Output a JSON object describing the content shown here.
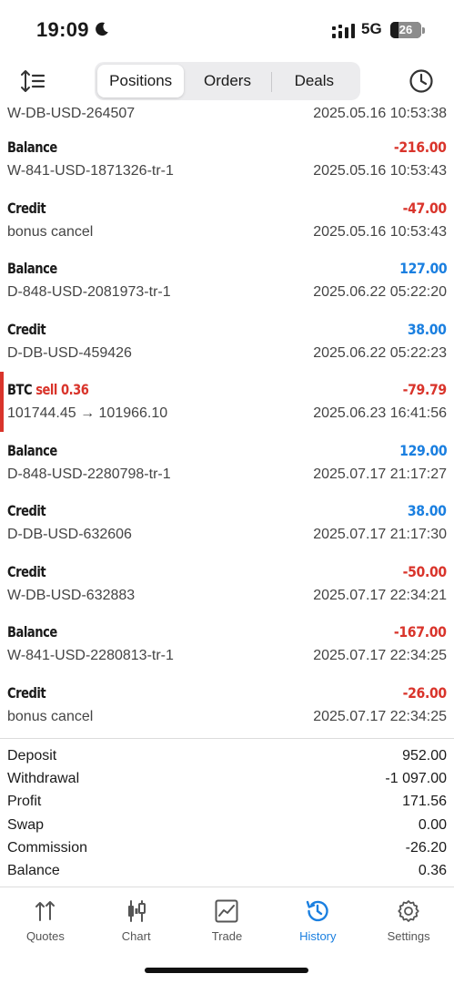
{
  "status_bar": {
    "time": "19:09",
    "network": "5G",
    "battery": "26",
    "battery_level": 0.26
  },
  "toolbar": {
    "tabs": [
      {
        "label": "Positions",
        "active": true
      },
      {
        "label": "Orders",
        "active": false
      },
      {
        "label": "Deals",
        "active": false
      }
    ]
  },
  "deals": [
    {
      "title": "",
      "amount": "",
      "sub": "W-DB-USD-264507",
      "time": "2025.05.16 10:53:38",
      "partial": true
    },
    {
      "title": "Balance",
      "amount": "-216.00",
      "sign": "neg",
      "sub": "W-841-USD-1871326-tr-1",
      "time": "2025.05.16 10:53:43"
    },
    {
      "title": "Credit",
      "amount": "-47.00",
      "sign": "neg",
      "sub": "bonus cancel",
      "time": "2025.05.16 10:53:43"
    },
    {
      "title": "Balance",
      "amount": "127.00",
      "sign": "pos",
      "sub": "D-848-USD-2081973-tr-1",
      "time": "2025.06.22 05:22:20"
    },
    {
      "title": "Credit",
      "amount": "38.00",
      "sign": "pos",
      "sub": "D-DB-USD-459426",
      "time": "2025.06.22 05:22:23"
    },
    {
      "title": "BTC",
      "title_extra": "sell 0.36",
      "amount": "-79.79",
      "sign": "neg",
      "sub": "101744.45 → 101966.10",
      "time": "2025.06.23 16:41:56",
      "trade": true
    },
    {
      "title": "Balance",
      "amount": "129.00",
      "sign": "pos",
      "sub": "D-848-USD-2280798-tr-1",
      "time": "2025.07.17 21:17:27"
    },
    {
      "title": "Credit",
      "amount": "38.00",
      "sign": "pos",
      "sub": "D-DB-USD-632606",
      "time": "2025.07.17 21:17:30"
    },
    {
      "title": "Credit",
      "amount": "-50.00",
      "sign": "neg",
      "sub": "W-DB-USD-632883",
      "time": "2025.07.17 22:34:21"
    },
    {
      "title": "Balance",
      "amount": "-167.00",
      "sign": "neg",
      "sub": "W-841-USD-2280813-tr-1",
      "time": "2025.07.17 22:34:25"
    },
    {
      "title": "Credit",
      "amount": "-26.00",
      "sign": "neg",
      "sub": "bonus cancel",
      "time": "2025.07.17 22:34:25"
    }
  ],
  "summary": [
    {
      "label": "Deposit",
      "value": "952.00"
    },
    {
      "label": "Withdrawal",
      "value": "-1 097.00"
    },
    {
      "label": "Profit",
      "value": "171.56"
    },
    {
      "label": "Swap",
      "value": "0.00"
    },
    {
      "label": "Commission",
      "value": "-26.20"
    },
    {
      "label": "Balance",
      "value": "0.36"
    }
  ],
  "tabbar": {
    "items": [
      {
        "label": "Quotes",
        "icon": "quotes-icon",
        "active": false
      },
      {
        "label": "Chart",
        "icon": "chart-icon",
        "active": false
      },
      {
        "label": "Trade",
        "icon": "trade-icon",
        "active": false
      },
      {
        "label": "History",
        "icon": "history-icon",
        "active": true
      },
      {
        "label": "Settings",
        "icon": "settings-icon",
        "active": false
      }
    ]
  },
  "colors": {
    "negative": "#d9342b",
    "positive": "#1a7fe0",
    "active_tab": "#1a7fe0"
  }
}
